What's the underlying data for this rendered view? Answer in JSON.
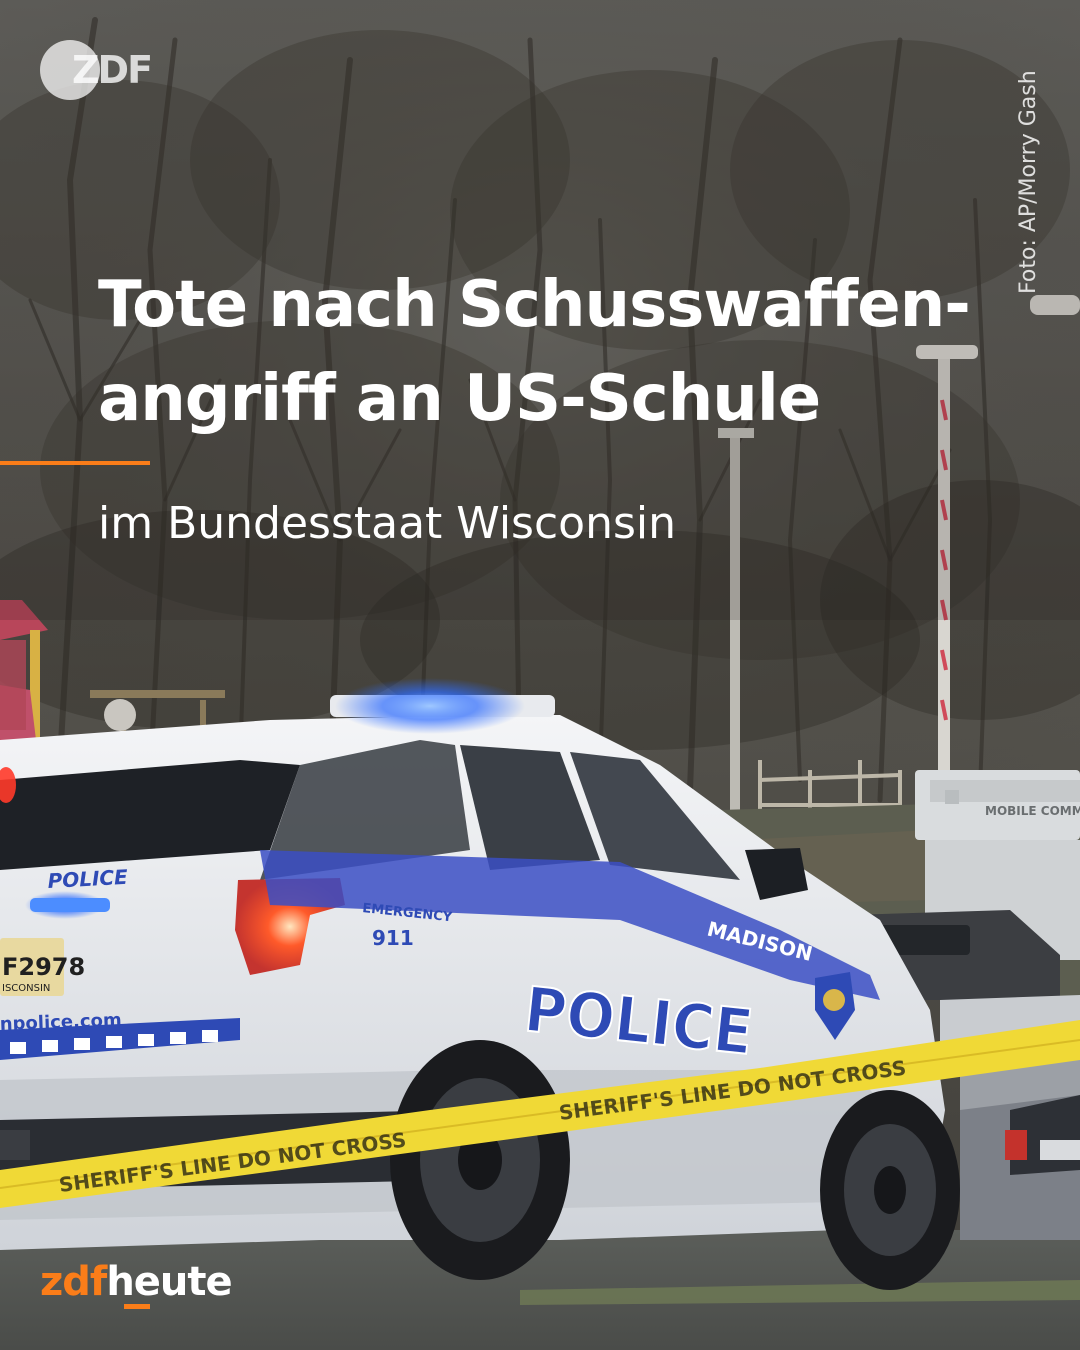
{
  "post": {
    "headline_line1": "Tote nach Schusswaffen-",
    "headline_line2": "angriff an US-Schule",
    "subline": "im Bundesstaat Wisconsin",
    "photo_credit": "Foto: AP/Morry Gash",
    "accent_color": "#fa7d19"
  },
  "logos": {
    "top_badge": "ZDF",
    "brand_part1": "zdf",
    "brand_part2": "heute"
  },
  "photo": {
    "car_door_label": "POLICE",
    "car_rear_label": "POLICE",
    "car_hood_label": "MADISON",
    "car_emergency_label": "EMERGENCY",
    "car_emergency_number": "911",
    "license_plate": "F2978",
    "plate_state": "ISCONSIN",
    "website": "npolice.com",
    "tape_text": "SHERIFF'S LINE DO NOT CROSS",
    "trailer_text": "MOBILE COMMAND"
  }
}
